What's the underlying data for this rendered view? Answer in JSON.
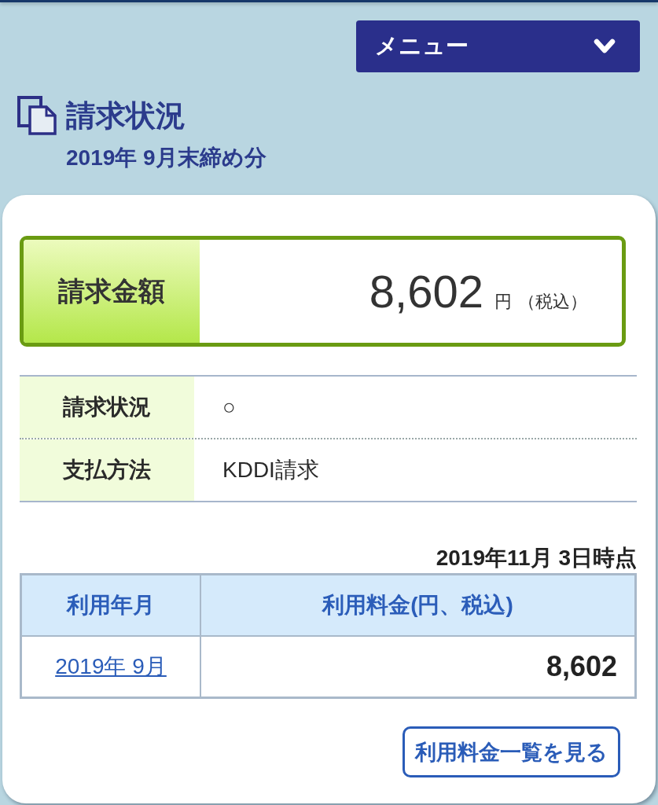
{
  "menu": {
    "label": "メニュー"
  },
  "header": {
    "title": "請求状況",
    "subtitle": "2019年 9月末締め分"
  },
  "billing_amount": {
    "label": "請求金額",
    "amount": "8,602",
    "unit": "円",
    "tax_note": "（税込）"
  },
  "details": [
    {
      "label": "請求状況",
      "value": "○"
    },
    {
      "label": "支払方法",
      "value": "KDDI請求"
    }
  ],
  "as_of": "2019年11月 3日時点",
  "usage_table": {
    "columns": [
      "利用年月",
      "利用料金(円、税込)"
    ],
    "rows": [
      {
        "month": "2019年 9月",
        "amount": "8,602"
      }
    ]
  },
  "list_button": {
    "label": "利用料金一覧を見る"
  }
}
